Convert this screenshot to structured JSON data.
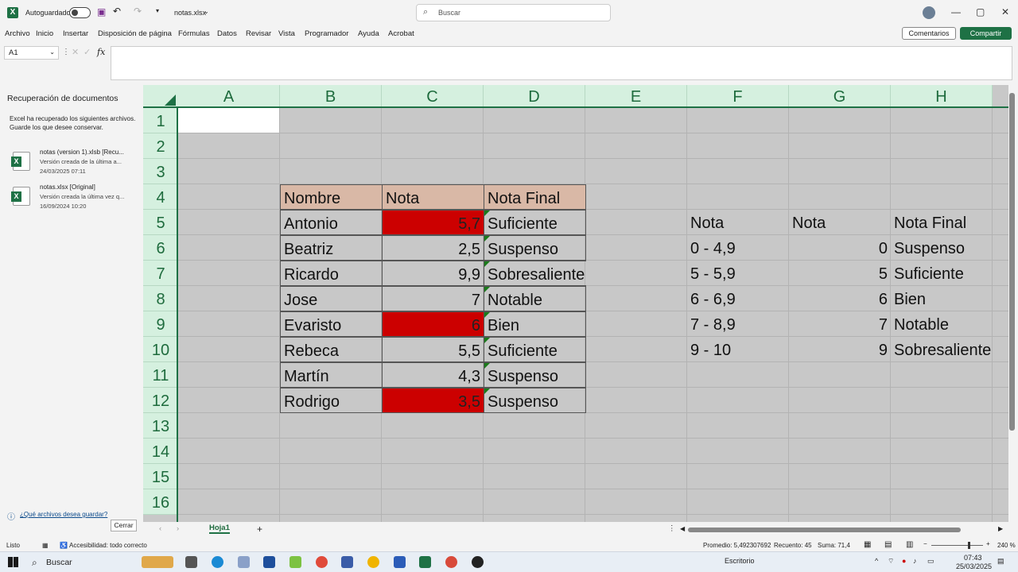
{
  "titlebar": {
    "autosave_label": "Autoguardado",
    "filename": "notas.xlsx",
    "search_placeholder": "Buscar",
    "minimize": "—",
    "restore": "▢",
    "close": "✕"
  },
  "menu": {
    "items": [
      "Archivo",
      "Inicio",
      "Insertar",
      "Disposición de página",
      "Fórmulas",
      "Datos",
      "Revisar",
      "Vista",
      "Programador",
      "Ayuda",
      "Acrobat"
    ],
    "comments_label": "Comentarios",
    "share_label": "Compartir"
  },
  "formula_bar": {
    "name_box": "A1",
    "fx": "fx",
    "content": ""
  },
  "recovery": {
    "title": "Recuperación de documentos",
    "text": "Excel ha recuperado los siguientes archivos. Guarde los que desee conservar.",
    "files": [
      {
        "name": "notas (version 1).xlsb  [Recu...",
        "desc": "Versión creada de la última a...",
        "date": "24/03/2025 07:11"
      },
      {
        "name": "notas.xlsx  [Original]",
        "desc": "Versión creada la última vez q...",
        "date": "16/09/2024 10:20"
      }
    ],
    "help_link": "¿Qué archivos desea guardar?",
    "close_button": "Cerrar"
  },
  "grid": {
    "columns": [
      "A",
      "B",
      "C",
      "D",
      "E",
      "F",
      "G",
      "H"
    ],
    "rows": [
      "1",
      "2",
      "3",
      "4",
      "5",
      "6",
      "7",
      "8",
      "9",
      "10",
      "11",
      "12",
      "13",
      "14",
      "15",
      "16"
    ],
    "table_headers": {
      "nombre": "Nombre",
      "nota": "Nota",
      "nota_final": "Nota Final"
    },
    "students": [
      {
        "name": "Antonio",
        "score": "5,7",
        "final": "Suficiente",
        "highlight": true
      },
      {
        "name": "Beatriz",
        "score": "2,5",
        "final": "Suspenso",
        "highlight": false
      },
      {
        "name": "Ricardo",
        "score": "9,9",
        "final": "Sobresaliente",
        "highlight": false
      },
      {
        "name": "Jose",
        "score": "7",
        "final": "Notable",
        "highlight": false
      },
      {
        "name": "Evaristo",
        "score": "6",
        "final": "Bien",
        "highlight": true
      },
      {
        "name": "Rebeca",
        "score": "5,5",
        "final": "Suficiente",
        "highlight": false
      },
      {
        "name": "Martín",
        "score": "4,3",
        "final": "Suspenso",
        "highlight": false
      },
      {
        "name": "Rodrigo",
        "score": "3,5",
        "final": "Suspenso",
        "highlight": true
      }
    ],
    "lookup_headers": {
      "range": "Nota",
      "min": "Nota",
      "label": "Nota Final"
    },
    "lookup": [
      {
        "range": "0 - 4,9",
        "min": "0",
        "label": "Suspenso"
      },
      {
        "range": "5 - 5,9",
        "min": "5",
        "label": "Suficiente"
      },
      {
        "range": "6 - 6,9",
        "min": "6",
        "label": "Bien"
      },
      {
        "range": "7 - 8,9",
        "min": "7",
        "label": "Notable"
      },
      {
        "range": "9 - 10",
        "min": "9",
        "label": "Sobresaliente"
      }
    ],
    "highlight_color": "#cc0000",
    "header_fill": "#d9b8a6"
  },
  "sheets": {
    "active": "Hoja1",
    "add": "+"
  },
  "status": {
    "ready": "Listo",
    "accessibility": "Accesibilidad: todo correcto",
    "average": "Promedio: 5,492307692",
    "count": "Recuento: 45",
    "sum": "Suma: 71,4",
    "zoom": "240 %"
  },
  "taskbar": {
    "search": "Buscar",
    "desktop": "Escritorio",
    "time": "07:43",
    "date": "25/03/2025"
  }
}
